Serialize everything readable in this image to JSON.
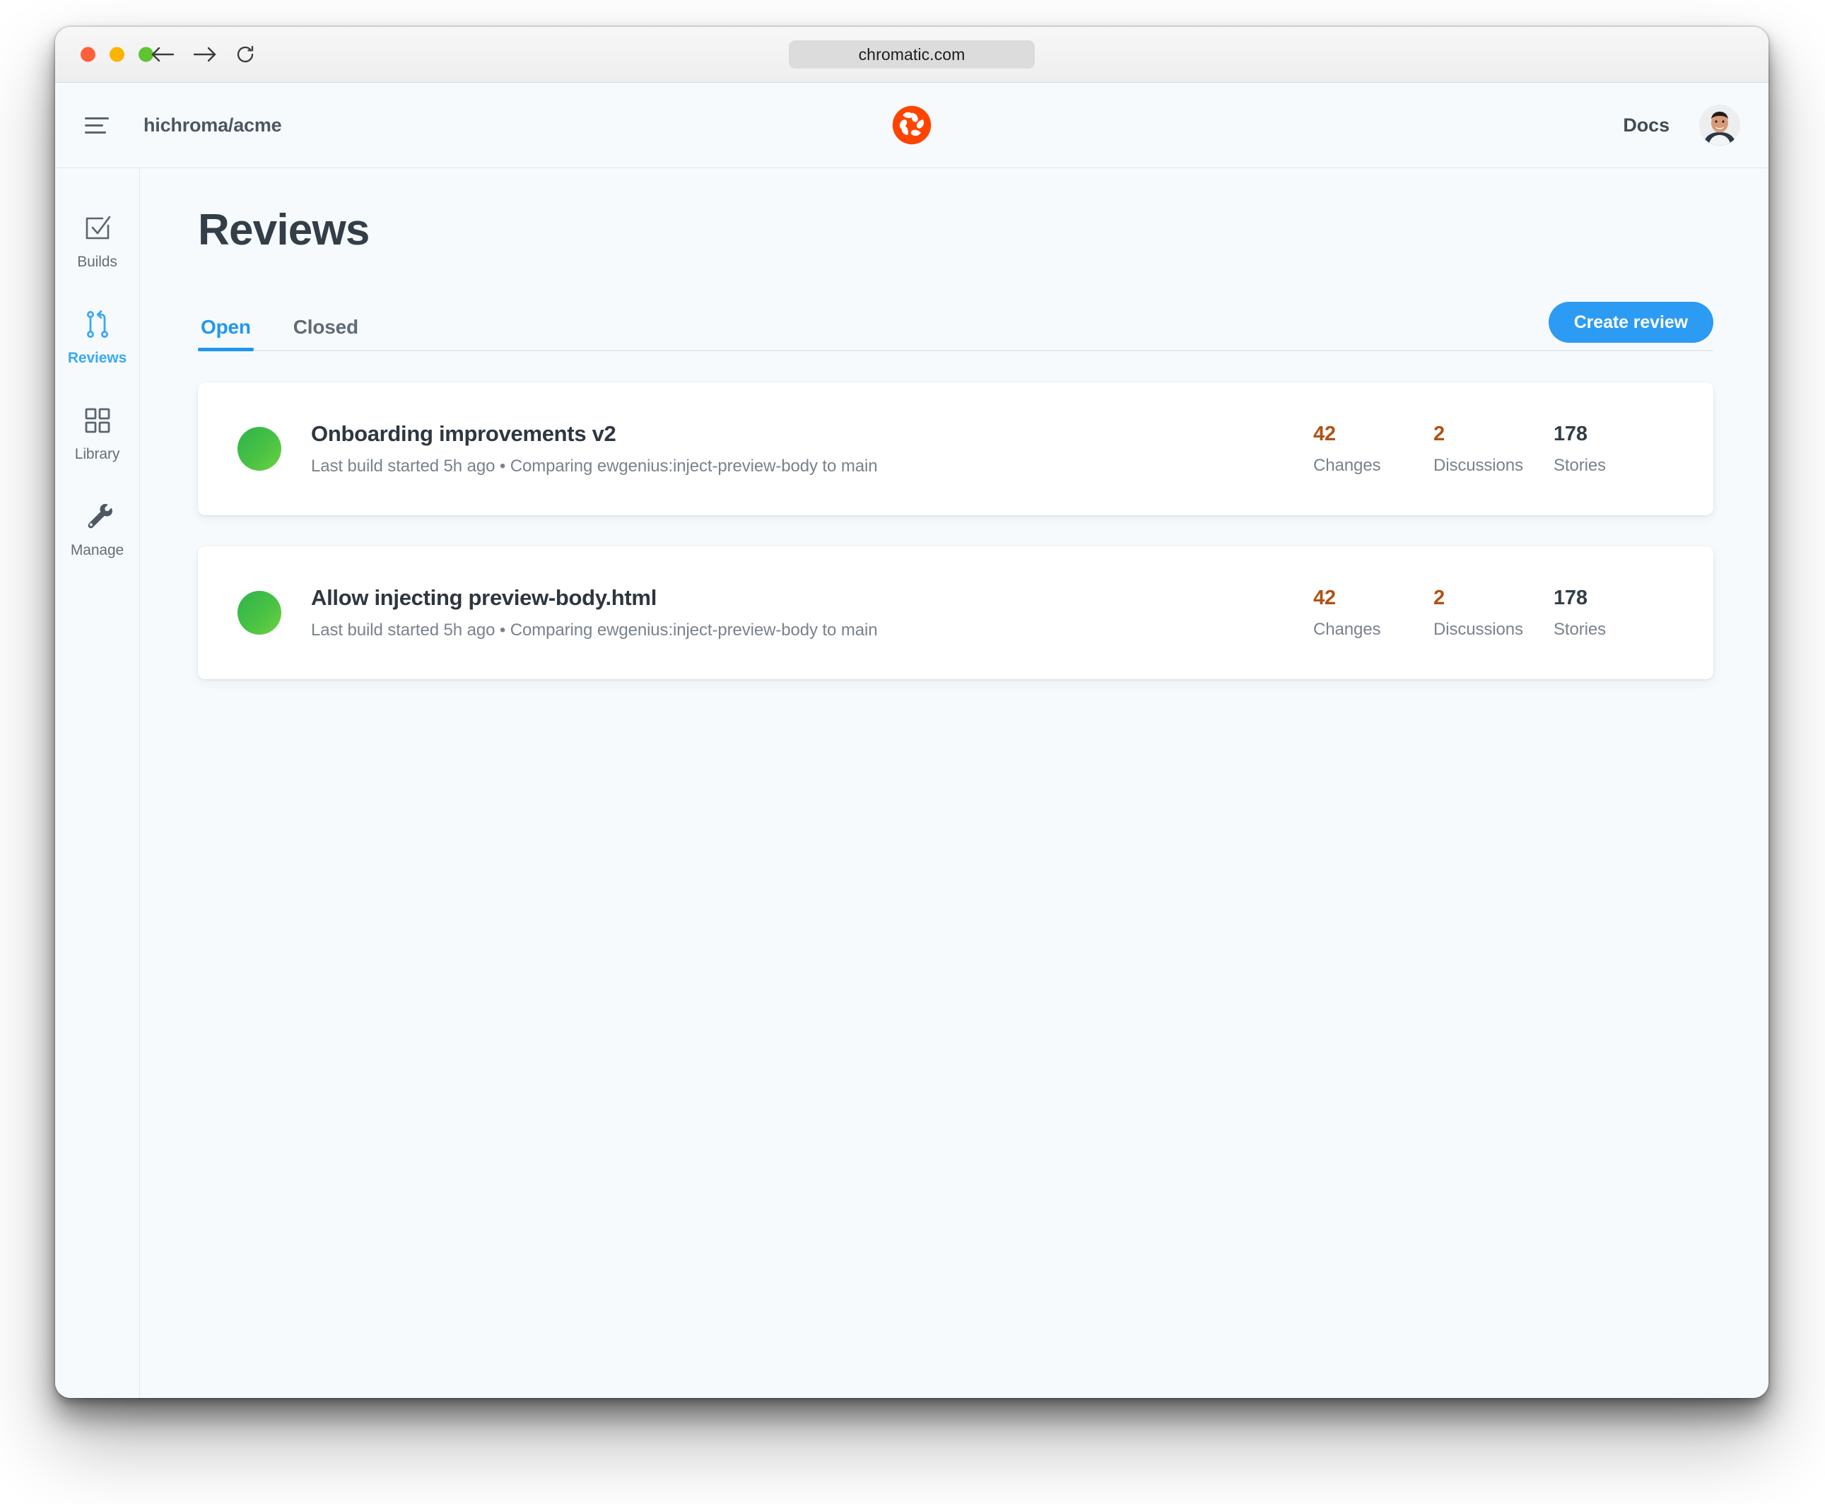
{
  "browser": {
    "url": "chromatic.com",
    "traffic_lights": [
      "close-red",
      "minimize-amber",
      "maximize-green"
    ],
    "back_icon": "arrow-left-icon",
    "forward_icon": "arrow-right-icon",
    "reload_icon": "reload-icon"
  },
  "header": {
    "menu_icon": "hamburger-menu-icon",
    "breadcrumb": "hichroma/acme",
    "logo_icon": "chromatic-logo-icon",
    "docs_label": "Docs",
    "avatar_icon": "user-avatar"
  },
  "sidebar": {
    "items": [
      {
        "label": "Builds",
        "icon": "checkbox-check-icon",
        "active": false
      },
      {
        "label": "Reviews",
        "icon": "pull-request-icon",
        "active": true
      },
      {
        "label": "Library",
        "icon": "grid-squares-icon",
        "active": false
      },
      {
        "label": "Manage",
        "icon": "wrench-icon",
        "active": false
      }
    ]
  },
  "main": {
    "title": "Reviews",
    "tabs": [
      {
        "label": "Open",
        "active": true
      },
      {
        "label": "Closed",
        "active": false
      }
    ],
    "create_button": "Create review",
    "reviews": [
      {
        "status": "green",
        "title": "Onboarding improvements v2",
        "subtitle": "Last build started 5h ago • Comparing ewgenius:inject-preview-body to main",
        "stats": [
          {
            "value": "42",
            "label": "Changes",
            "tone": "warn"
          },
          {
            "value": "2",
            "label": "Discussions",
            "tone": "warn"
          },
          {
            "value": "178",
            "label": "Stories",
            "tone": "neutral"
          }
        ]
      },
      {
        "status": "green",
        "title": "Allow injecting preview-body.html",
        "subtitle": "Last build started 5h ago • Comparing ewgenius:inject-preview-body to main",
        "stats": [
          {
            "value": "42",
            "label": "Changes",
            "tone": "warn"
          },
          {
            "value": "2",
            "label": "Discussions",
            "tone": "warn"
          },
          {
            "value": "178",
            "label": "Stories",
            "tone": "neutral"
          }
        ]
      }
    ]
  },
  "colors": {
    "accent_blue": "#2b9bf4",
    "active_blue": "#3aa8f5",
    "brand_orange": "#ff4400",
    "status_green": "#49c244",
    "warn_orange": "#b15214",
    "text_dark": "#333e48",
    "text_muted": "#79828c",
    "page_bg": "#f6fafc"
  }
}
